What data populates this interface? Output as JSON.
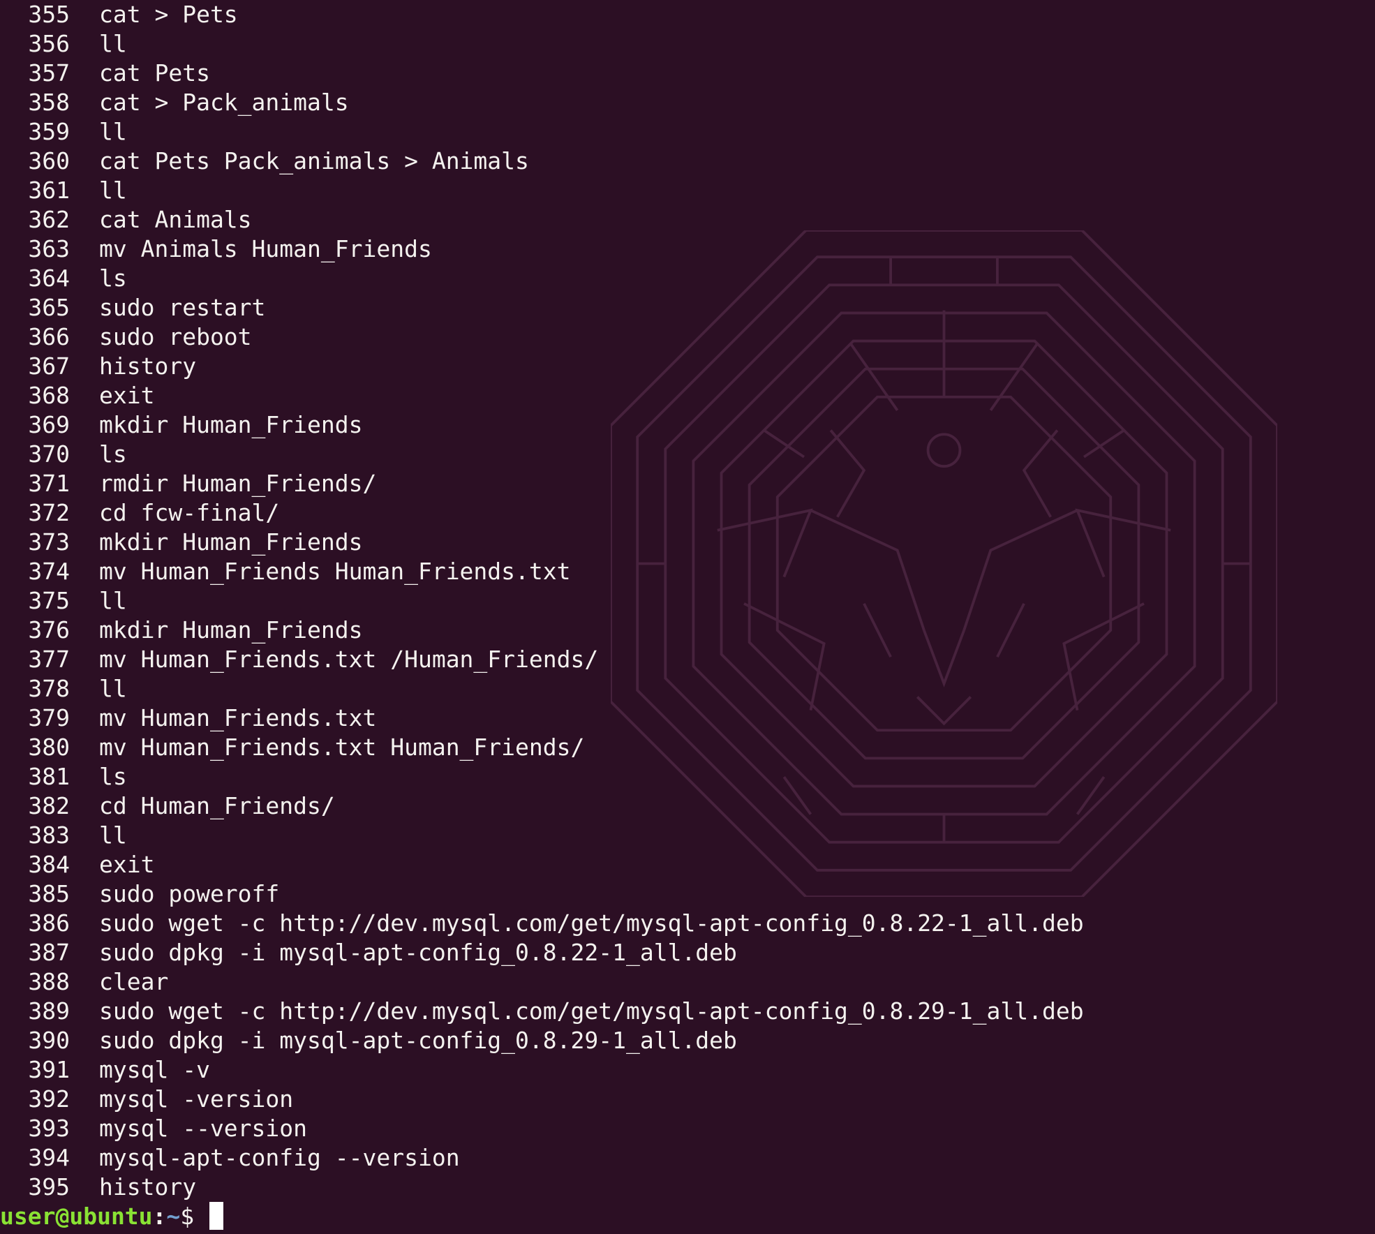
{
  "terminal": {
    "background": "#2c0f24",
    "history": [
      {
        "num": "355",
        "cmd": "cat > Pets"
      },
      {
        "num": "356",
        "cmd": "ll"
      },
      {
        "num": "357",
        "cmd": "cat Pets"
      },
      {
        "num": "358",
        "cmd": "cat > Pack_animals"
      },
      {
        "num": "359",
        "cmd": "ll"
      },
      {
        "num": "360",
        "cmd": "cat Pets Pack_animals > Animals"
      },
      {
        "num": "361",
        "cmd": "ll"
      },
      {
        "num": "362",
        "cmd": "cat Animals"
      },
      {
        "num": "363",
        "cmd": "mv Animals Human_Friends"
      },
      {
        "num": "364",
        "cmd": "ls"
      },
      {
        "num": "365",
        "cmd": "sudo restart"
      },
      {
        "num": "366",
        "cmd": "sudo reboot"
      },
      {
        "num": "367",
        "cmd": "history"
      },
      {
        "num": "368",
        "cmd": "exit"
      },
      {
        "num": "369",
        "cmd": "mkdir Human_Friends"
      },
      {
        "num": "370",
        "cmd": "ls"
      },
      {
        "num": "371",
        "cmd": "rmdir Human_Friends/"
      },
      {
        "num": "372",
        "cmd": "cd fcw-final/"
      },
      {
        "num": "373",
        "cmd": "mkdir Human_Friends"
      },
      {
        "num": "374",
        "cmd": "mv Human_Friends Human_Friends.txt"
      },
      {
        "num": "375",
        "cmd": "ll"
      },
      {
        "num": "376",
        "cmd": "mkdir Human_Friends"
      },
      {
        "num": "377",
        "cmd": "mv Human_Friends.txt /Human_Friends/"
      },
      {
        "num": "378",
        "cmd": "ll"
      },
      {
        "num": "379",
        "cmd": "mv Human_Friends.txt"
      },
      {
        "num": "380",
        "cmd": "mv Human_Friends.txt Human_Friends/"
      },
      {
        "num": "381",
        "cmd": "ls"
      },
      {
        "num": "382",
        "cmd": "cd Human_Friends/"
      },
      {
        "num": "383",
        "cmd": "ll"
      },
      {
        "num": "384",
        "cmd": "exit"
      },
      {
        "num": "385",
        "cmd": "sudo poweroff"
      },
      {
        "num": "386",
        "cmd": "sudo wget -c http://dev.mysql.com/get/mysql-apt-config_0.8.22-1_all.deb"
      },
      {
        "num": "387",
        "cmd": "sudo dpkg -i mysql-apt-config_0.8.22-1_all.deb"
      },
      {
        "num": "388",
        "cmd": "clear"
      },
      {
        "num": "389",
        "cmd": "sudo wget -c http://dev.mysql.com/get/mysql-apt-config_0.8.29-1_all.deb"
      },
      {
        "num": "390",
        "cmd": "sudo dpkg -i mysql-apt-config_0.8.29-1_all.deb"
      },
      {
        "num": "391",
        "cmd": "mysql -v"
      },
      {
        "num": "392",
        "cmd": "mysql -version"
      },
      {
        "num": "393",
        "cmd": "mysql --version"
      },
      {
        "num": "394",
        "cmd": "mysql-apt-config --version"
      },
      {
        "num": "395",
        "cmd": "history"
      }
    ],
    "prompt": {
      "user_host": "user@ubuntu",
      "colon": ":",
      "path": "~",
      "symbol": "$ "
    },
    "colors": {
      "text": "#f4f2ef",
      "prompt_user": "#8ae234",
      "prompt_path": "#729fcf"
    },
    "wallpaper_icon": "octagon-maze-emblem-icon"
  }
}
